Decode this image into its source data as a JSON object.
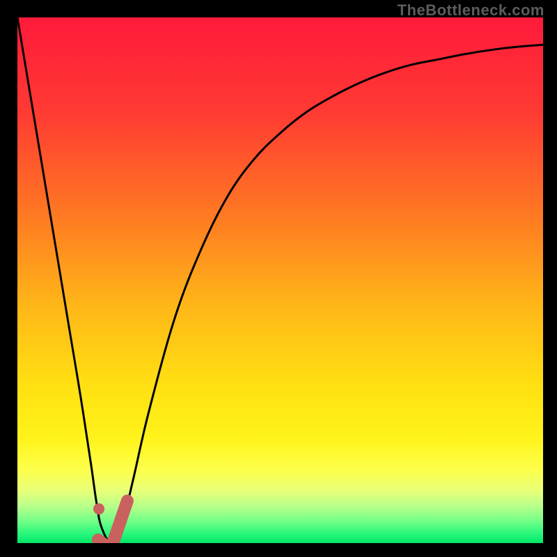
{
  "watermark": "TheBottleneck.com",
  "chart_data": {
    "type": "line",
    "title": "",
    "xlabel": "",
    "ylabel": "",
    "xlim": [
      0,
      100
    ],
    "ylim": [
      0,
      100
    ],
    "series": [
      {
        "name": "bottleneck-curve",
        "x": [
          0,
          5,
          10,
          12,
          14,
          15,
          16,
          18,
          20,
          22,
          25,
          30,
          35,
          40,
          45,
          50,
          55,
          60,
          65,
          70,
          75,
          80,
          85,
          90,
          95,
          100
        ],
        "values": [
          100,
          70,
          40,
          28,
          15,
          8,
          3,
          0,
          4,
          12,
          25,
          43,
          56,
          66,
          73,
          78,
          82,
          85,
          87.5,
          89.5,
          91,
          92,
          93,
          93.8,
          94.4,
          94.8
        ]
      }
    ],
    "markers": [
      {
        "name": "marker-dot",
        "x": 15.5,
        "y": 6.5,
        "shape": "circle",
        "color": "#c9615f"
      },
      {
        "name": "marker-check",
        "x": 18,
        "y": 3,
        "shape": "check",
        "color": "#c9615f"
      }
    ],
    "background_gradient": {
      "stops": [
        {
          "offset": 0.0,
          "color": "#ff1a3a"
        },
        {
          "offset": 0.18,
          "color": "#ff3a33"
        },
        {
          "offset": 0.38,
          "color": "#ff7a22"
        },
        {
          "offset": 0.55,
          "color": "#ffb718"
        },
        {
          "offset": 0.7,
          "color": "#ffe012"
        },
        {
          "offset": 0.8,
          "color": "#fff31a"
        },
        {
          "offset": 0.86,
          "color": "#fdff4a"
        },
        {
          "offset": 0.9,
          "color": "#e8ff78"
        },
        {
          "offset": 0.93,
          "color": "#b8ff8a"
        },
        {
          "offset": 0.96,
          "color": "#6dff86"
        },
        {
          "offset": 0.985,
          "color": "#20f57a"
        },
        {
          "offset": 1.0,
          "color": "#04e765"
        }
      ]
    }
  }
}
